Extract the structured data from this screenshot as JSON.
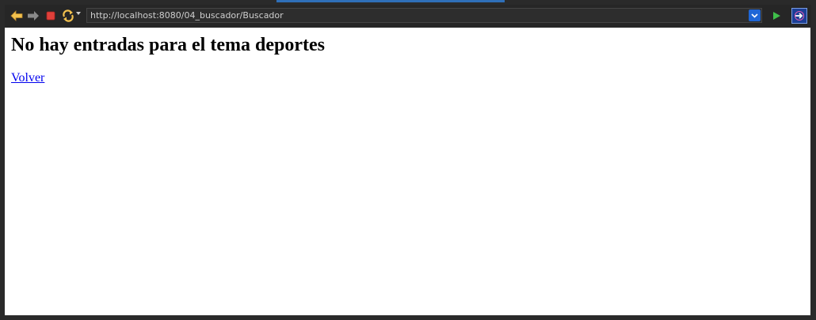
{
  "browser": {
    "url": "http://localhost:8080/04_buscador/Buscador",
    "icons": {
      "back": "back-arrow-icon",
      "forward": "forward-arrow-icon",
      "stop": "stop-icon",
      "reload": "reload-icon",
      "url_dropdown": "chevron-down-icon",
      "go": "play-go-icon",
      "extension": "extension-icon"
    },
    "colors": {
      "accent": "#1f66d6",
      "back_arrow": "#f2c14e",
      "stop": "#e0403a",
      "go": "#3fbf4a"
    }
  },
  "page": {
    "heading": "No hay entradas para el tema deportes",
    "back_link": "Volver"
  }
}
